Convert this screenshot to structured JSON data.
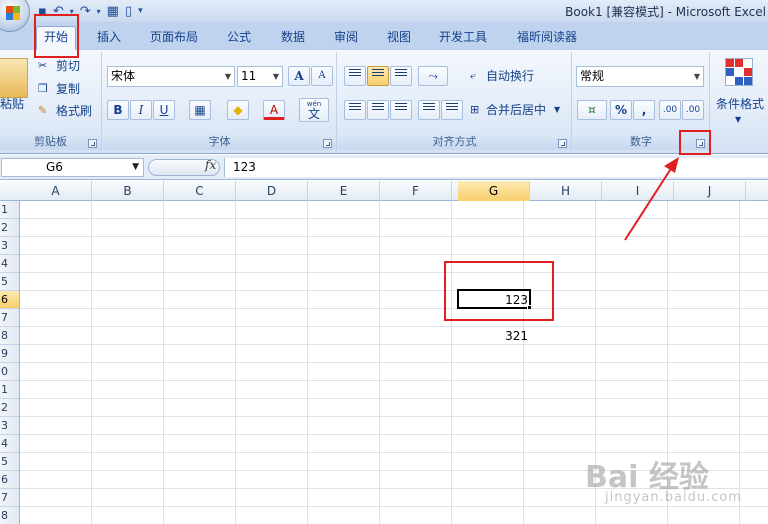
{
  "window": {
    "title": "Book1  [兼容模式] - Microsoft Excel"
  },
  "tabs": [
    {
      "label": "开始",
      "active": true
    },
    {
      "label": "插入"
    },
    {
      "label": "页面布局"
    },
    {
      "label": "公式"
    },
    {
      "label": "数据"
    },
    {
      "label": "审阅"
    },
    {
      "label": "视图"
    },
    {
      "label": "开发工具"
    },
    {
      "label": "福昕阅读器"
    }
  ],
  "clipboard": {
    "paste": "粘贴",
    "cut": "剪切",
    "copy": "复制",
    "format_painter": "格式刷",
    "label": "剪贴板"
  },
  "font": {
    "name": "宋体",
    "size": "11",
    "grow": "A",
    "shrink": "A",
    "bold": "B",
    "italic": "I",
    "underline": "U",
    "font_color_letter": "A",
    "phonetic_top": "wén",
    "phonetic": "文",
    "label": "字体"
  },
  "alignment": {
    "wrap_text": "自动换行",
    "merge_center": "合并后居中",
    "label": "对齐方式"
  },
  "number": {
    "format": "常规",
    "percent": "%",
    "comma": ",",
    "inc_decimal": ".00",
    "dec_decimal": ".00",
    "label": "数字"
  },
  "styles": {
    "conditional_format": "条件格式"
  },
  "formula_bar": {
    "name_box": "G6",
    "fx": "fx",
    "value": "123"
  },
  "columns": [
    "A",
    "B",
    "C",
    "D",
    "E",
    "F",
    "G",
    "H",
    "I",
    "J"
  ],
  "rows": [
    "1",
    "2",
    "3",
    "4",
    "5",
    "6",
    "7",
    "8",
    "9",
    "0",
    "1",
    "2",
    "3",
    "4",
    "5",
    "6",
    "7",
    "8"
  ],
  "cells": {
    "G6": "123",
    "G8": "321"
  },
  "watermark": {
    "brand": "Bai 经验",
    "url": "jingyan.baidu.com"
  },
  "colors": {
    "highlight": "#e02020",
    "selection_header": "#f8cf6b",
    "ribbon": "#dbe7f6"
  }
}
